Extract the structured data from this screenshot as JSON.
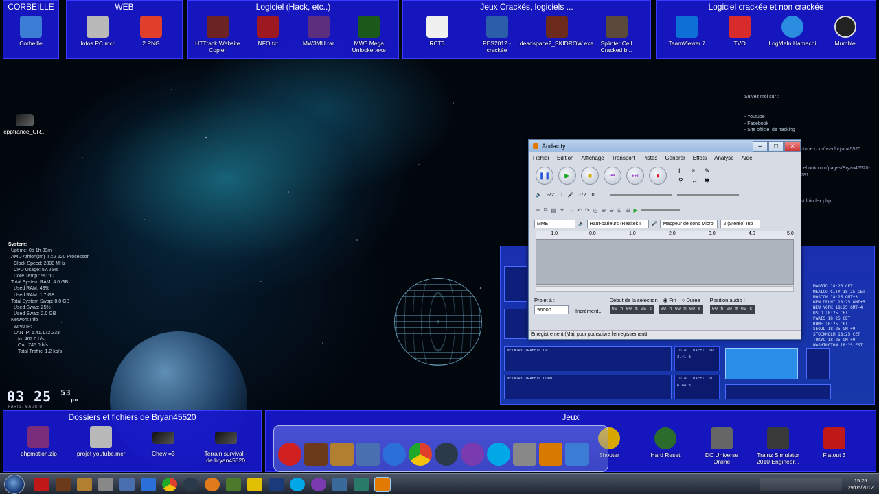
{
  "fences_top": [
    {
      "title": "CORBEILLE",
      "icons": [
        {
          "label": "Corbeille",
          "icon": "recycle-bin-icon",
          "color": "#3b7cd4"
        }
      ]
    },
    {
      "title": "WEB",
      "icons": [
        {
          "label": "Infos PC.mcr",
          "icon": "cassette-icon",
          "color": "#b9b9b9"
        },
        {
          "label": "2.PNG",
          "icon": "image-icon",
          "color": "#e0402b"
        }
      ]
    },
    {
      "title": "Logiciel (Hack, etc..)",
      "icons": [
        {
          "label": "HTTrack Website Copier",
          "icon": "httrack-icon",
          "color": "#6c2323"
        },
        {
          "label": "NFO.txt",
          "icon": "text-file-icon",
          "color": "#9e1822"
        },
        {
          "label": "MW3MU.rar",
          "icon": "winrar-icon",
          "color": "#5b2f7e"
        },
        {
          "label": "MW3 Mega Unlocker.exe",
          "icon": "unlocker-icon",
          "color": "#1c5a1c"
        }
      ]
    },
    {
      "title": "Jeux Crackés, logiciels ...",
      "icons": [
        {
          "label": "RCT3",
          "icon": "panda-icon",
          "color": "#f0f0f0"
        },
        {
          "label": "PES2012 - crackée",
          "icon": "pes-icon",
          "color": "#2a5ea8"
        },
        {
          "label": "deadspace2_SKIDROW.exe",
          "icon": "deadspace-icon",
          "color": "#6b2a1b"
        },
        {
          "label": "Splinter Cell Cracked b...",
          "icon": "splinter-cell-icon",
          "color": "#5b4a3a"
        }
      ]
    },
    {
      "title": "Logiciel crackée et non crackée",
      "icons": [
        {
          "label": "TeamViewer 7",
          "icon": "teamviewer-icon",
          "color": "#0e6fd6"
        },
        {
          "label": "TVO",
          "icon": "tvo-icon",
          "color": "#d82b2b"
        },
        {
          "label": "LogMeIn Hamachi",
          "icon": "hamachi-icon",
          "color": "#2a8de0"
        },
        {
          "label": "Mumble",
          "icon": "mumble-icon",
          "color": "#222"
        }
      ]
    }
  ],
  "desktop_icon": {
    "label": "cppfrance_CR...",
    "icon": "shortcut-icon"
  },
  "sysinfo": {
    "header": "System:",
    "lines": [
      "Uptime: 0d 1h 39m",
      "AMD Athlon(tm) II X2 220 Processor",
      "Clock Speed: 2800 MHz",
      "CPU Usage: 57.25%",
      "Core Temp.: %1°C",
      "Total System RAM: 4.0 GB",
      "Used RAM: 43%",
      "Used RAM: 1.7 GB",
      "Total System Swap: 8.0 GB",
      "Used Swap: 25%",
      "Used Swap: 2.0 GB",
      "Network Info",
      "WAN IP:",
      "LAN IP: 5.41.172.233",
      "In: 462.0 b/s",
      "Out: 745.0 b/s",
      "Total Traffic: 1.2 kb/s"
    ]
  },
  "clock": {
    "hours": "03",
    "minutes": "25",
    "seconds": "53",
    "ampm": "pm",
    "city": "PARIS, MADRID"
  },
  "follow": {
    "label": "Suivez moi sur :",
    "links": [
      "- Youtube",
      "- Facebook",
      "- Site officiel de hacking"
    ]
  },
  "urls": [
    "utube.com/user/bryan45520",
    "cebook.com/pages/Bryan45520-",
    "281",
    "st.fr/index.php"
  ],
  "audacity": {
    "title": "Audacity",
    "menu": [
      "Fichier",
      "Edition",
      "Affichage",
      "Transport",
      "Pistes",
      "Générer",
      "Effets",
      "Analyse",
      "Aide"
    ],
    "meter_left": [
      "-72",
      "0"
    ],
    "meter_right": [
      "-72",
      "0"
    ],
    "host": "MME",
    "output": "Haut-parleurs (Realtek I",
    "input": "Mappeur de sons Micro",
    "channels": "2 (Stéréo) Inp",
    "ruler": [
      "-1,0",
      "0,0",
      "1,0",
      "2,0",
      "3,0",
      "4,0",
      "5,0"
    ],
    "project_rate_label": "Projet à :",
    "project_rate": "96000",
    "increment_label": "Incrément...",
    "selection_label": "Début de la sélection",
    "end_label": "Fin",
    "duration_label": "Durée",
    "position_label": "Position audio :",
    "time1": "00 h 00 m 00 s",
    "time2": "00 h 00 m 00 s",
    "time3": "00 h 00 m 00 s",
    "status": "Enregistrement (Maj. pour poursuivre l'enregistrement)"
  },
  "world_clock": [
    "MADRID 18:25 CET",
    "MEXICO CITY 18:25 CET",
    "MOSCOW 18:25 GMT+3",
    "NEW DELHI 18:25 GMT+5",
    "NEW YORK 18:25 GMT-4",
    "OSLO 18:25 CET",
    "PARIS 18:25 CET",
    "ROME 18:25 CET",
    "SEOUL 18:25 GMT+9",
    "STOCKHOLM 18:25 CET",
    "TOKYO 18:25 GMT+9",
    "WASHINGTON 18:25 EST"
  ],
  "traffic": {
    "up_label": "NETWORK TRAFFIC UP",
    "down_label": "NETWORK TRAFFIC DOWN",
    "total_up_label": "TOTAL TRAFFIC UP",
    "total_up": "3.41 B",
    "total_dl_label": "TOTAL TRAFFIC DL",
    "total_dl": "6.84 B"
  },
  "fences_bottom": [
    {
      "title": "Dossiers et fichiers de Bryan45520",
      "icons": [
        {
          "label": "phpmotion.zip",
          "icon": "archive-icon",
          "color": "#7a2d7a"
        },
        {
          "label": "projet youtube.mcr",
          "icon": "cassette-icon",
          "color": "#b9b9b9"
        },
        {
          "label": "Chew =3",
          "icon": "shortcut-icon",
          "color": "#333"
        },
        {
          "label": "Terrain survival - de bryan45520",
          "icon": "shortcut-icon",
          "color": "#333"
        }
      ]
    },
    {
      "title": "Jeux",
      "icons": [
        {
          "label": "Shooter",
          "icon": "biohazard-icon",
          "color": "#d8a800"
        },
        {
          "label": "Hard Reset",
          "icon": "hard-reset-icon",
          "color": "#2b6b2b"
        },
        {
          "label": "DC Universe Online",
          "icon": "dc-universe-icon",
          "color": "#666"
        },
        {
          "label": "Trainz Simulator 2010 Engineer...",
          "icon": "trainz-icon",
          "color": "#3a3a3a"
        },
        {
          "label": "Flatout 3",
          "icon": "flatout-icon",
          "color": "#c01818"
        }
      ]
    }
  ],
  "dock": [
    {
      "icon": "media-player-icon",
      "color": "#d02020"
    },
    {
      "icon": "minecraft-icon",
      "color": "#6b3a1a"
    },
    {
      "icon": "books-icon",
      "color": "#b08030"
    },
    {
      "icon": "vb-icon",
      "color": "#4a6fb0"
    },
    {
      "icon": "lightning-icon",
      "color": "#2b6fd8"
    },
    {
      "icon": "chrome-icon",
      "color": "#e0402b"
    },
    {
      "icon": "steam-icon",
      "color": "#2a3a4a"
    },
    {
      "icon": "spiral-icon",
      "color": "#7a3ab0"
    },
    {
      "icon": "skype-icon",
      "color": "#00a8e8"
    },
    {
      "icon": "game-icon",
      "color": "#888"
    },
    {
      "icon": "lock-icon",
      "color": "#d87a00"
    },
    {
      "icon": "trash-icon",
      "color": "#3b7cd4"
    }
  ],
  "taskbar": [
    {
      "icon": "media-player-icon",
      "color": "#c01818"
    },
    {
      "icon": "minecraft-icon",
      "color": "#6b3a1a"
    },
    {
      "icon": "books-icon",
      "color": "#b08030"
    },
    {
      "icon": "settings-icon",
      "color": "#888"
    },
    {
      "icon": "vb-icon",
      "color": "#4a6fb0"
    },
    {
      "icon": "lightning-icon",
      "color": "#2b6fd8"
    },
    {
      "icon": "chrome-icon",
      "color": "#e0402b"
    },
    {
      "icon": "steam-icon",
      "color": "#2a3a4a"
    },
    {
      "icon": "firefox-icon",
      "color": "#e07a1a"
    },
    {
      "icon": "minecraft-icon",
      "color": "#4a7a2a"
    },
    {
      "icon": "font-icon",
      "color": "#e0c000"
    },
    {
      "icon": "photoshop-icon",
      "color": "#1a3a7a"
    },
    {
      "icon": "skype-icon",
      "color": "#00a8e8"
    },
    {
      "icon": "spiral-icon",
      "color": "#7a3ab0"
    },
    {
      "icon": "folder-icon",
      "color": "#3a6a9a"
    },
    {
      "icon": "monitor-icon",
      "color": "#2a7a6a"
    },
    {
      "icon": "audacity-icon",
      "color": "#e07a00"
    }
  ],
  "tray": {
    "time": "15:25",
    "date": "29/05/2012"
  }
}
